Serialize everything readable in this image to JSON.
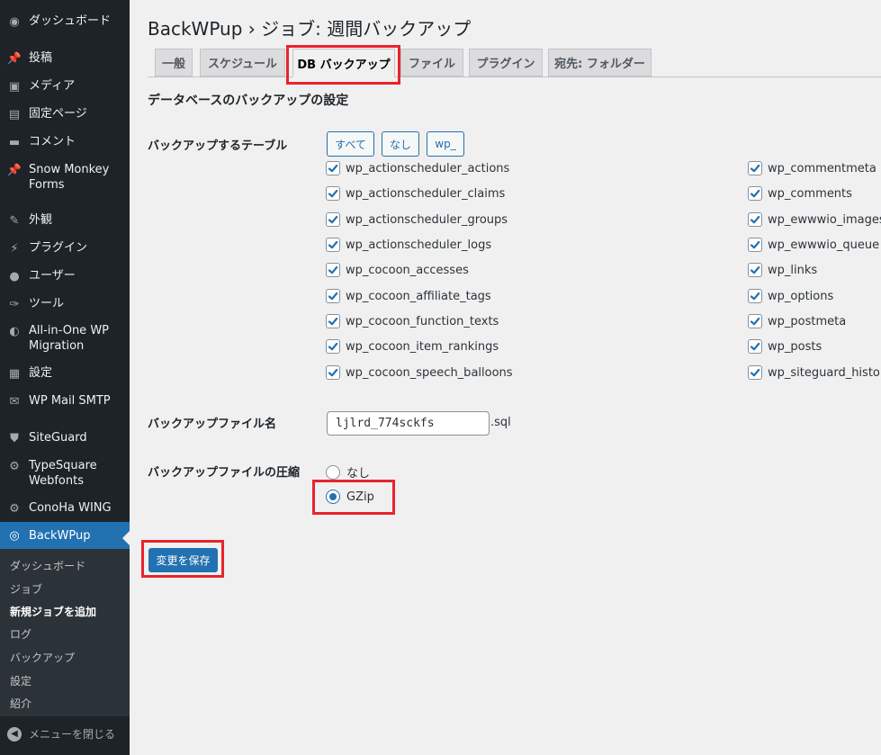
{
  "sidebar": {
    "items": [
      {
        "label": "ダッシュボード",
        "icon": "dashboard-icon"
      },
      {
        "label": "投稿",
        "icon": "pin-icon"
      },
      {
        "label": "メディア",
        "icon": "media-icon"
      },
      {
        "label": "固定ページ",
        "icon": "page-icon"
      },
      {
        "label": "コメント",
        "icon": "comment-icon"
      },
      {
        "label": "Snow Monkey Forms",
        "icon": "pin-icon"
      },
      {
        "label": "外観",
        "icon": "brush-icon"
      },
      {
        "label": "プラグイン",
        "icon": "plugin-icon"
      },
      {
        "label": "ユーザー",
        "icon": "user-icon"
      },
      {
        "label": "ツール",
        "icon": "wrench-icon"
      },
      {
        "label": "All-in-One WP Migration",
        "icon": "migration-icon"
      },
      {
        "label": "設定",
        "icon": "settings-icon"
      },
      {
        "label": "WP Mail SMTP",
        "icon": "mail-icon"
      },
      {
        "label": "SiteGuard",
        "icon": "shield-icon"
      },
      {
        "label": "TypeSquare Webfonts",
        "icon": "gear-icon"
      },
      {
        "label": "ConoHa WING",
        "icon": "gear-icon"
      },
      {
        "label": "BackWPup",
        "icon": "backwpup-icon"
      }
    ],
    "submenu": [
      "ダッシュボード",
      "ジョブ",
      "新規ジョブを追加",
      "ログ",
      "バックアップ",
      "設定",
      "紹介"
    ],
    "collapse_label": "メニューを閉じる"
  },
  "page": {
    "title": "BackWPup › ジョブ: 週間バックアップ",
    "tabs": [
      "一般",
      "スケジュール",
      "DB バックアップ",
      "ファイル",
      "プラグイン",
      "宛先: フォルダー"
    ],
    "active_tab": "DB バックアップ",
    "section_heading": "データベースのバックアップの設定"
  },
  "tables": {
    "label": "バックアップするテーブル",
    "buttons": [
      "すべて",
      "なし",
      "wp_"
    ],
    "left": [
      "wp_actionscheduler_actions",
      "wp_actionscheduler_claims",
      "wp_actionscheduler_groups",
      "wp_actionscheduler_logs",
      "wp_cocoon_accesses",
      "wp_cocoon_affiliate_tags",
      "wp_cocoon_function_texts",
      "wp_cocoon_item_rankings",
      "wp_cocoon_speech_balloons"
    ],
    "right": [
      "wp_commentmeta",
      "wp_comments",
      "wp_ewwwio_images",
      "wp_ewwwio_queue",
      "wp_links",
      "wp_options",
      "wp_postmeta",
      "wp_posts",
      "wp_siteguard_history"
    ],
    "all_checked": true
  },
  "filename": {
    "label": "バックアップファイル名",
    "value": "ljlrd_774sckfs",
    "extension": ".sql"
  },
  "compression": {
    "label": "バックアップファイルの圧縮",
    "options": [
      "なし",
      "GZip"
    ],
    "selected": "GZip"
  },
  "save_button": "変更を保存",
  "colors": {
    "accent": "#2271b1",
    "highlight": "#e8242b",
    "sidebar_bg": "#1d2327"
  }
}
